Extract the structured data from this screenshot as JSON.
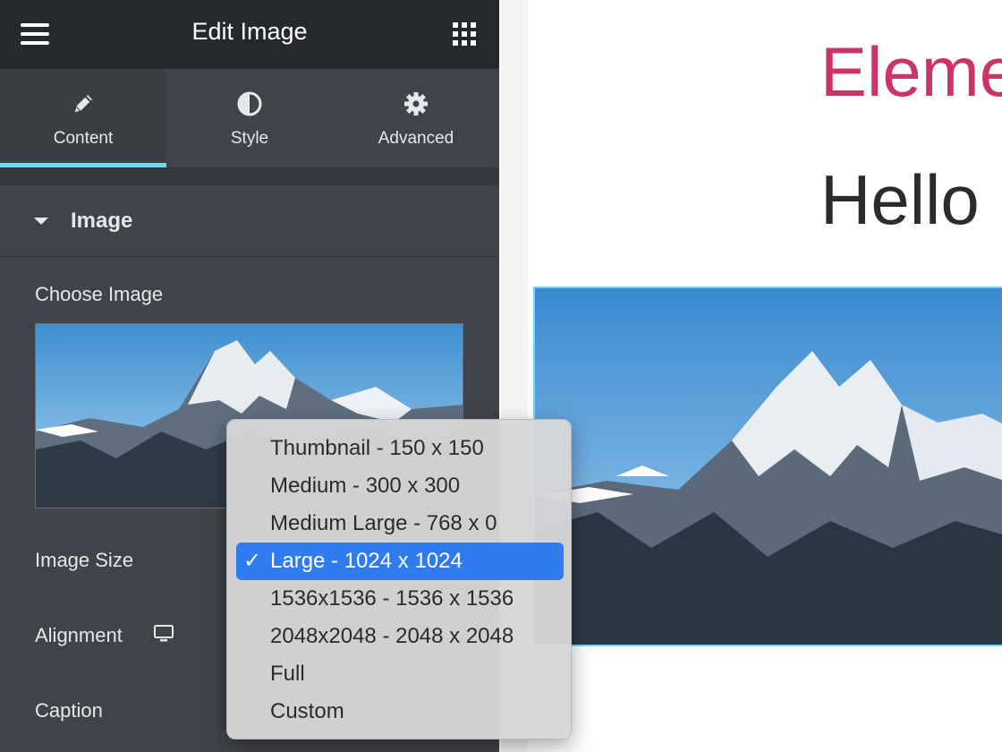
{
  "header": {
    "title": "Edit Image",
    "menu_icon": "hamburger-icon",
    "apps_icon": "grid-icon"
  },
  "tabs": [
    {
      "label": "Content",
      "icon": "pencil-icon",
      "active": true
    },
    {
      "label": "Style",
      "icon": "half-circle-icon",
      "active": false
    },
    {
      "label": "Advanced",
      "icon": "gear-icon",
      "active": false
    }
  ],
  "section": {
    "title": "Image"
  },
  "controls": {
    "choose_image": "Choose Image",
    "image_size": "Image Size",
    "alignment": "Alignment",
    "caption": "Caption"
  },
  "image_size_options": [
    {
      "label": "Thumbnail - 150 x 150",
      "selected": false
    },
    {
      "label": "Medium - 300 x 300",
      "selected": false
    },
    {
      "label": "Medium Large - 768 x 0",
      "selected": false
    },
    {
      "label": "Large - 1024 x 1024",
      "selected": true
    },
    {
      "label": "1536x1536 - 1536 x 1536",
      "selected": false
    },
    {
      "label": "2048x2048 - 2048 x 2048",
      "selected": false
    },
    {
      "label": "Full",
      "selected": false
    },
    {
      "label": "Custom",
      "selected": false
    }
  ],
  "preview": {
    "site_title": "Eleme",
    "heading": "Hello"
  },
  "colors": {
    "accent": "#71d7f7",
    "brand": "#cc3366",
    "selection": "#2f7bf0",
    "panel": "#404349"
  }
}
